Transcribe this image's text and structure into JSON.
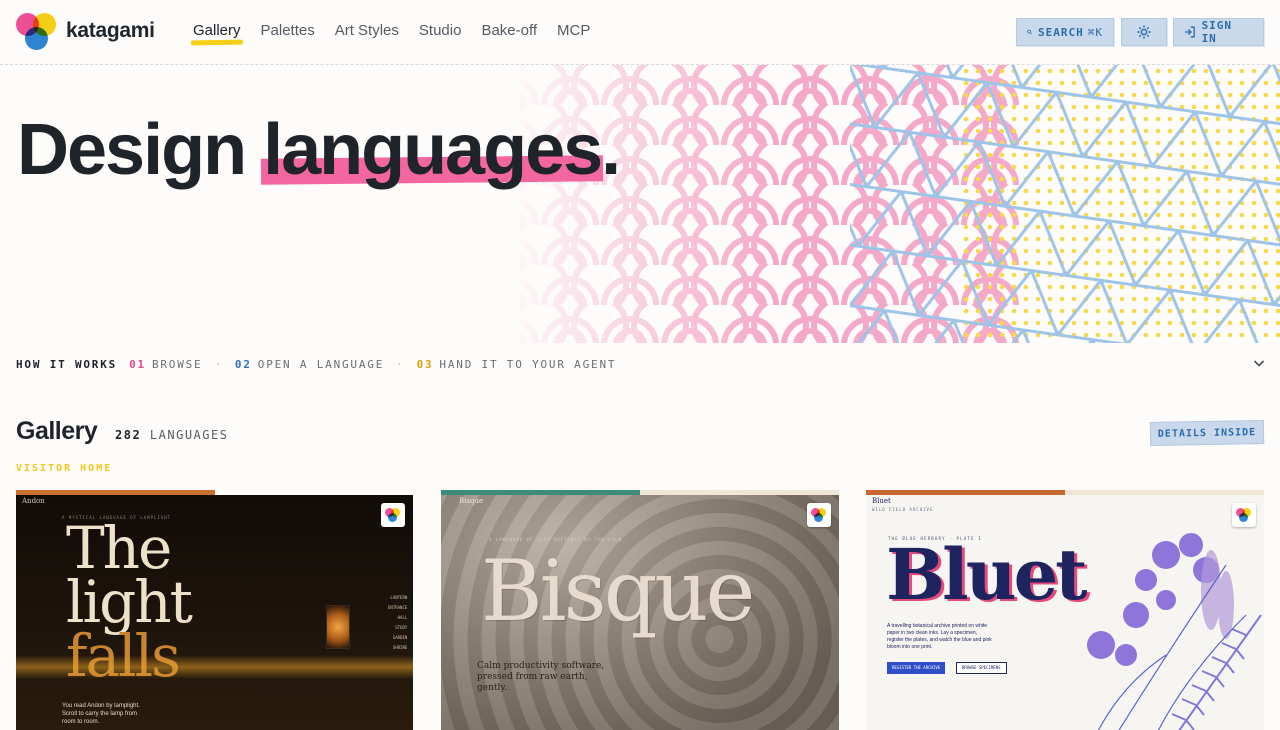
{
  "brand": {
    "name": "katagami"
  },
  "nav": {
    "items": [
      "Gallery",
      "Palettes",
      "Art Styles",
      "Studio",
      "Bake-off",
      "MCP"
    ],
    "active": "Gallery"
  },
  "toolbar": {
    "search_label": "SEARCH",
    "search_shortcut": "⌘K",
    "theme_icon": "sun-icon",
    "signin_label": "SIGN IN"
  },
  "hero": {
    "title_plain": "Design ",
    "title_highlight": "languages",
    "title_end": "."
  },
  "how": {
    "label": "HOW IT WORKS",
    "steps": [
      {
        "num": "01",
        "text": "BROWSE"
      },
      {
        "num": "02",
        "text": "OPEN A LANGUAGE"
      },
      {
        "num": "03",
        "text": "HAND IT TO YOUR AGENT"
      }
    ]
  },
  "gallery": {
    "title": "Gallery",
    "count": "282",
    "count_label": "LANGUAGES",
    "details_label": "DETAILS INSIDE",
    "visitor_label": "VISITOR HOME"
  },
  "cards": [
    {
      "name": "Andon",
      "kicker": "A MYSTICAL LANGUAGE OF LAMPLIGHT",
      "headline": [
        "The",
        "light",
        "falls"
      ],
      "body": "You read Andon by lamplight. Scroll to carry the lamp from room to room.",
      "menu": [
        "LANTERN",
        "ENTRANCE",
        "HALL",
        "STUDY",
        "GARDEN",
        "SHRINE"
      ],
      "colors": {
        "bar": "#c8702e",
        "bg": "#1a120b",
        "text": "#eee3cd",
        "accent": "#c9852e"
      }
    },
    {
      "name": "Bisque",
      "kicker": "A LANGUAGE OF CLAY SOFTENED BY THE KILN",
      "headline": [
        "Bisque"
      ],
      "body": "Calm productivity software, pressed from raw earth, gently.",
      "colors": {
        "bar": "#3b8c7a",
        "bg": "#8a7f73",
        "text": "#e6dbcc"
      }
    },
    {
      "name": "Bluet",
      "kicker": "THE BLUE HERBARY · PLATE I",
      "meta": "WILD FIELD ARCHIVE",
      "headline": [
        "Bluet"
      ],
      "body": "A travelling botanical archive printed on white paper in two clean inks. Lay a specimen, register the plates, and watch the blue and pink bloom into one print.",
      "buttons": [
        "REGISTER THE ARCHIVE",
        "BROWSE SPECIMENS"
      ],
      "colors": {
        "bar": "#c8682e",
        "bg": "#f6f5f2",
        "text": "#1e2460",
        "accent": "#e8497c"
      }
    }
  ],
  "colors": {
    "pink": "#f4669f",
    "yellow": "#f7cf18",
    "blue": "#2b6cb0"
  }
}
